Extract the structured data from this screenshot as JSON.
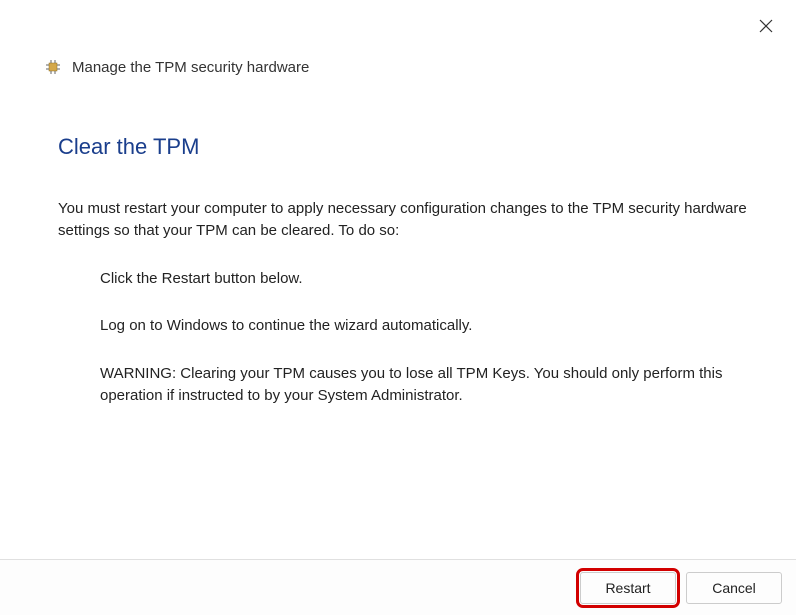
{
  "header": {
    "title": "Manage the TPM security hardware"
  },
  "content": {
    "heading": "Clear the TPM",
    "description": "You must restart your computer to apply necessary configuration changes to the TPM security hardware settings so that your TPM can be cleared. To do so:",
    "instructions": {
      "step1": "Click the Restart button below.",
      "step2": "Log on to Windows to continue the wizard automatically.",
      "warning": "WARNING: Clearing your TPM causes you to lose all TPM Keys. You should only perform this operation if instructed to by your System Administrator."
    }
  },
  "footer": {
    "restart_label": "Restart",
    "cancel_label": "Cancel"
  }
}
